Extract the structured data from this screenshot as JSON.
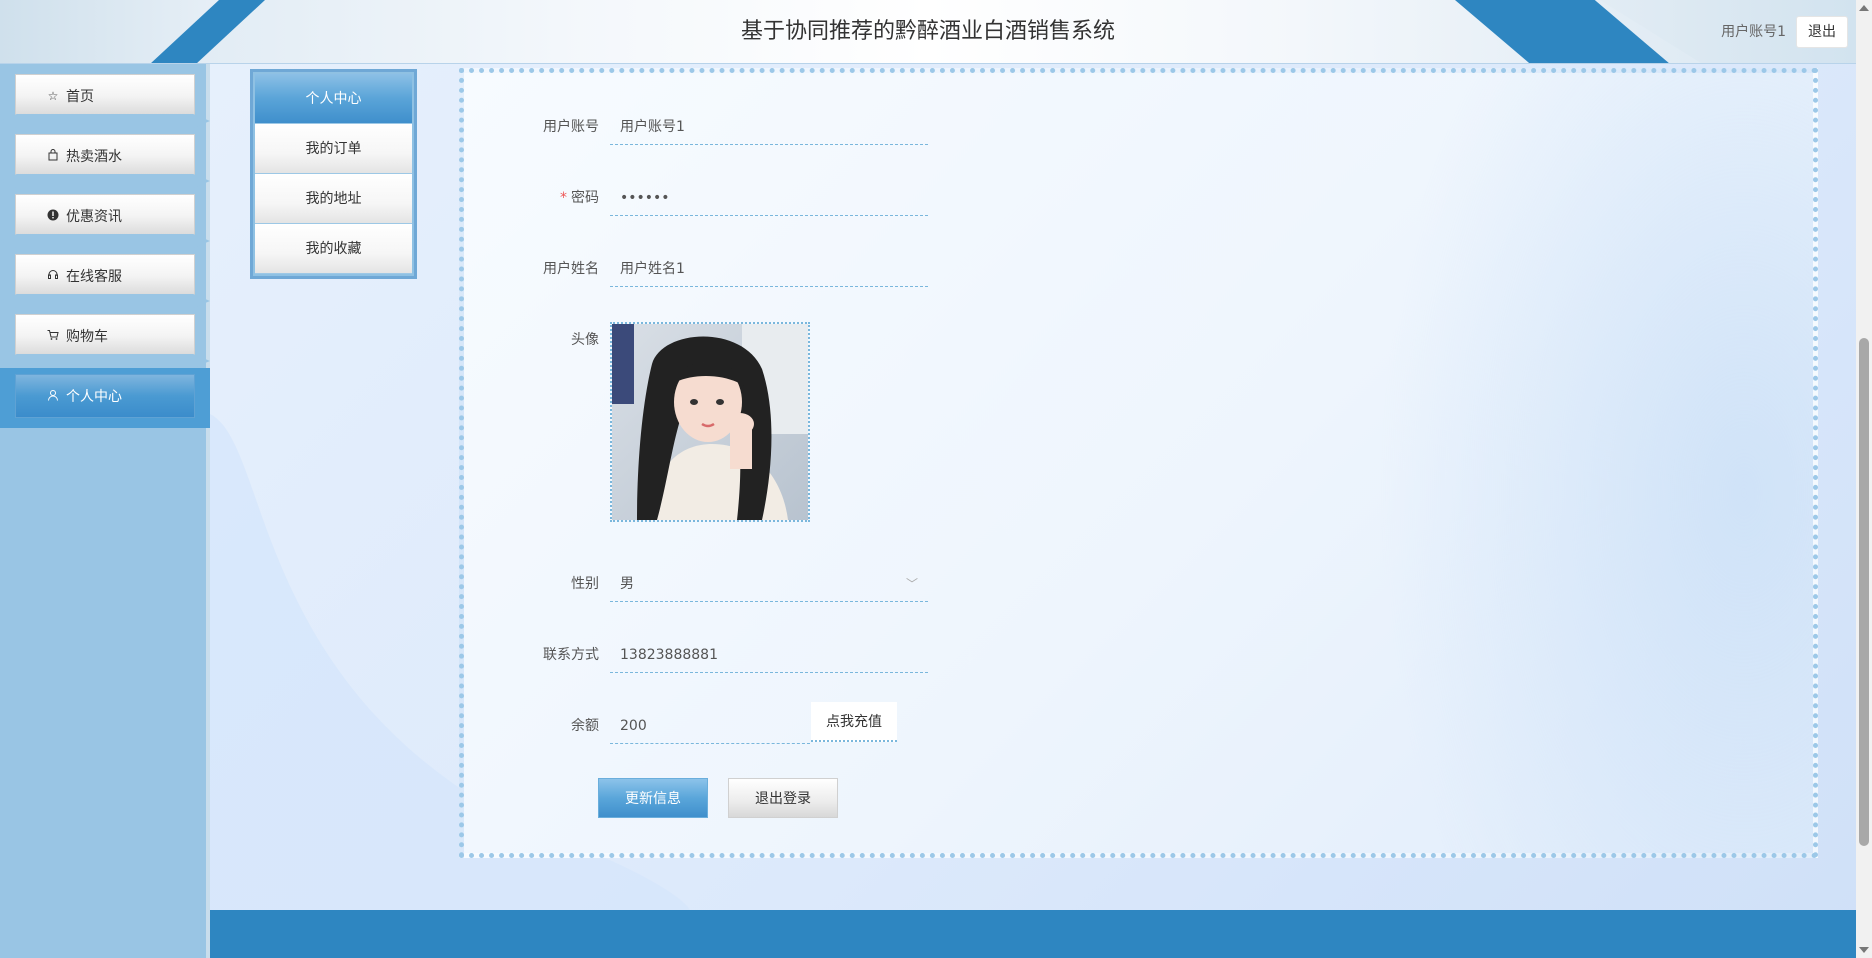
{
  "header": {
    "title": "基于协同推荐的黔醉酒业白酒销售系统",
    "username": "用户账号1",
    "logout_label": "退出"
  },
  "sidebar": {
    "items": [
      {
        "label": "首页",
        "icon": "star-icon",
        "active": false
      },
      {
        "label": "热卖酒水",
        "icon": "shopping-bag-icon",
        "active": false
      },
      {
        "label": "优惠资讯",
        "icon": "alert-circle-icon",
        "active": false
      },
      {
        "label": "在线客服",
        "icon": "headset-icon",
        "active": false
      },
      {
        "label": "购物车",
        "icon": "cart-icon",
        "active": false
      },
      {
        "label": "个人中心",
        "icon": "user-icon",
        "active": true
      }
    ]
  },
  "submenu": {
    "items": [
      {
        "label": "个人中心",
        "active": true
      },
      {
        "label": "我的订单",
        "active": false
      },
      {
        "label": "我的地址",
        "active": false
      },
      {
        "label": "我的收藏",
        "active": false
      }
    ]
  },
  "form": {
    "account_label": "用户账号",
    "account_value": "用户账号1",
    "password_required_mark": "*",
    "password_label": "密码",
    "password_value": "••••••",
    "name_label": "用户姓名",
    "name_value": "用户姓名1",
    "avatar_label": "头像",
    "gender_label": "性别",
    "gender_value": "男",
    "phone_label": "联系方式",
    "phone_value": "13823888881",
    "balance_label": "余额",
    "balance_value": "200",
    "recharge_label": "点我充值",
    "update_label": "更新信息",
    "logout_label": "退出登录"
  },
  "colors": {
    "primary": "#2e86c1",
    "sidebar": "#99c5e4",
    "active": "#4a9ad2",
    "required": "#ee5555"
  }
}
